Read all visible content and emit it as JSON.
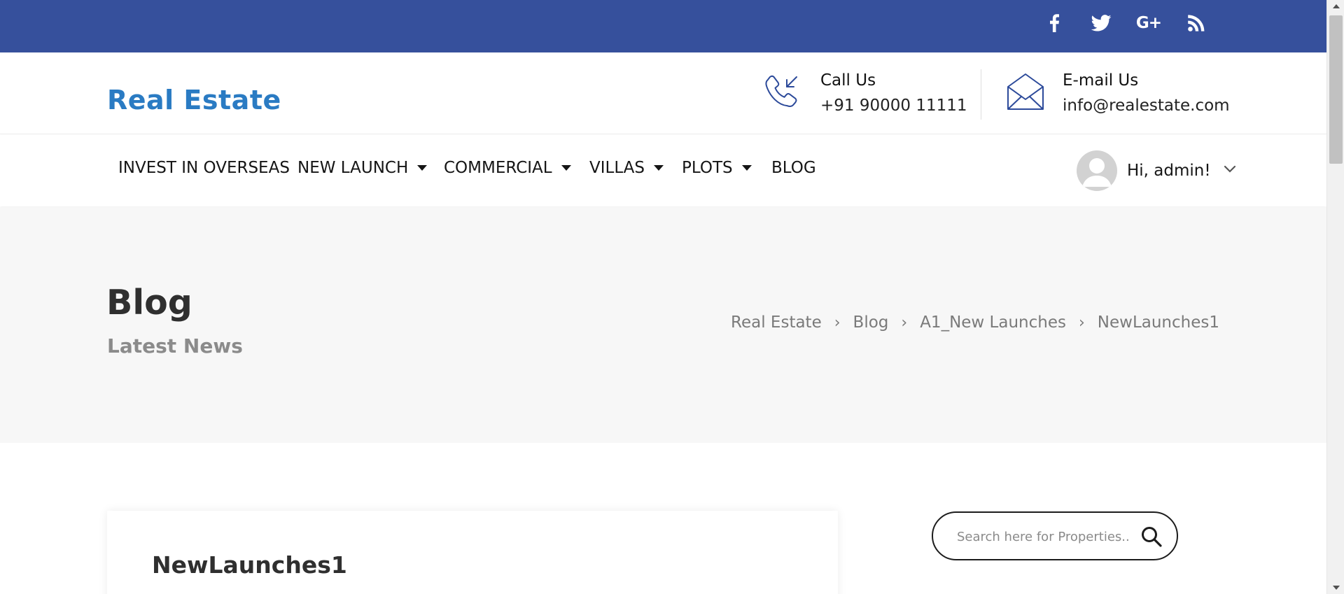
{
  "social": {
    "icons": [
      "facebook-icon",
      "twitter-icon",
      "google-plus-icon",
      "rss-icon"
    ],
    "google_plus_text": "G+"
  },
  "header": {
    "logo": "Real Estate",
    "call": {
      "title": "Call Us",
      "value": "+91 90000 11111",
      "icon": "phone-icon"
    },
    "email": {
      "title": "E-mail Us",
      "value": "info@realestate.com",
      "icon": "envelope-icon"
    }
  },
  "nav": {
    "items": [
      {
        "label": "INVEST IN OVERSEAS",
        "dropdown": false
      },
      {
        "label": "NEW LAUNCH",
        "dropdown": true
      },
      {
        "label": "COMMERCIAL",
        "dropdown": true
      },
      {
        "label": "VILLAS",
        "dropdown": true
      },
      {
        "label": "PLOTS",
        "dropdown": true
      },
      {
        "label": "BLOG",
        "dropdown": false
      }
    ],
    "user": {
      "greeting": "Hi, admin!",
      "icon": "avatar-icon"
    }
  },
  "banner": {
    "title": "Blog",
    "subtitle": "Latest News",
    "breadcrumb": [
      "Real Estate",
      "Blog",
      "A1_New Launches",
      "NewLaunches1"
    ],
    "separator": "›"
  },
  "post": {
    "title": "NewLaunches1"
  },
  "search": {
    "placeholder": "Search here for Properties..",
    "icon": "search-icon"
  },
  "colors": {
    "topbar": "#36509c",
    "logo": "#2a7bc3",
    "banner_bg": "#f7f7f7",
    "contact_icons": "#2c4a9a"
  }
}
